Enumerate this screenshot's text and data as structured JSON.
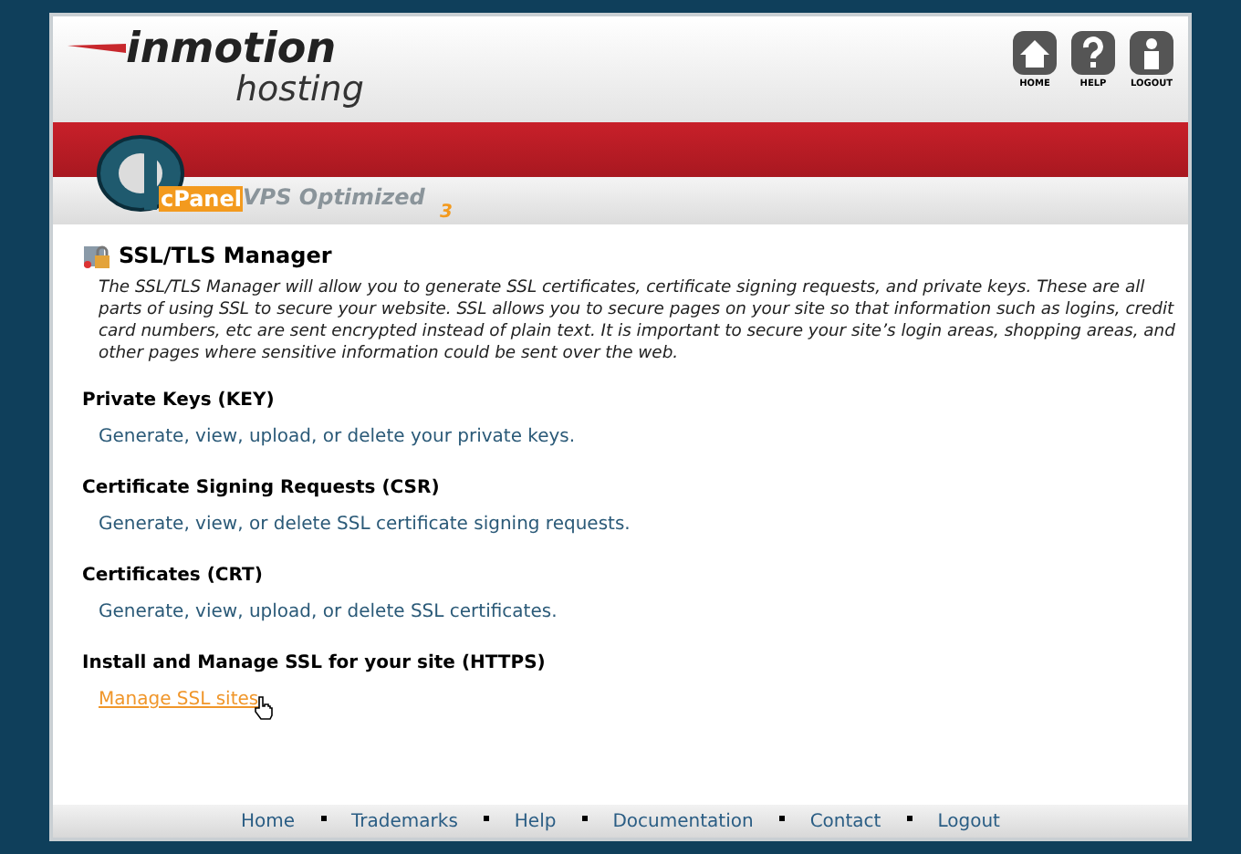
{
  "header": {
    "logo": {
      "brand": "inmotion",
      "sub": "hosting"
    },
    "nav_icons": [
      {
        "kind": "home",
        "label": "HOME"
      },
      {
        "kind": "help",
        "label": "HELP"
      },
      {
        "kind": "logout",
        "label": "LOGOUT"
      }
    ]
  },
  "banner": {
    "logo_text": "cPanel",
    "edition": "VPS Optimized",
    "version": "3"
  },
  "page": {
    "title": "SSL/TLS Manager",
    "intro": "The SSL/TLS Manager will allow you to generate SSL certificates, certificate signing requests, and private keys. These are all parts of using SSL to secure your website. SSL allows you to secure pages on your site so that information such as logins, credit card numbers, etc are sent encrypted instead of plain text. It is important to secure your site’s login areas, shopping areas, and other pages where sensitive information could be sent over the web.",
    "sections": [
      {
        "heading": "Private Keys (KEY)",
        "kind": "text",
        "body": "Generate, view, upload, or delete your private keys."
      },
      {
        "heading": "Certificate Signing Requests (CSR)",
        "kind": "text",
        "body": "Generate, view, or delete SSL certificate signing requests."
      },
      {
        "heading": "Certificates (CRT)",
        "kind": "text",
        "body": "Generate, view, upload, or delete SSL certificates."
      },
      {
        "heading": "Install and Manage SSL for your site (HTTPS)",
        "kind": "link",
        "body": "Manage SSL sites",
        "hovered": true
      }
    ]
  },
  "footer": {
    "links": [
      "Home",
      "Trademarks",
      "Help",
      "Documentation",
      "Contact",
      "Logout"
    ]
  }
}
